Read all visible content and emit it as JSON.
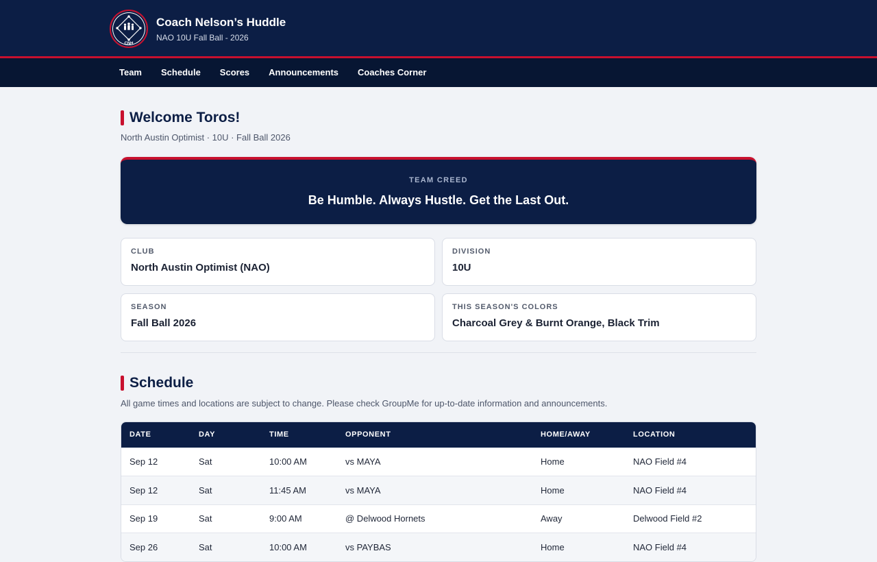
{
  "header": {
    "logo_monogram": "CNH",
    "title": "Coach Nelson’s Huddle",
    "subtitle": "NAO 10U Fall Ball - 2026"
  },
  "nav": {
    "items": [
      {
        "label": "Team"
      },
      {
        "label": "Schedule"
      },
      {
        "label": "Scores"
      },
      {
        "label": "Announcements"
      },
      {
        "label": "Coaches Corner"
      }
    ]
  },
  "welcome": {
    "title": "Welcome Toros!",
    "subline": "North Austin Optimist · 10U · Fall Ball 2026"
  },
  "creed": {
    "label": "TEAM CREED",
    "text": "Be Humble. Always Hustle. Get the Last Out."
  },
  "info": [
    {
      "label": "CLUB",
      "value": "North Austin Optimist (NAO)"
    },
    {
      "label": "DIVISION",
      "value": "10U"
    },
    {
      "label": "SEASON",
      "value": "Fall Ball 2026"
    },
    {
      "label": "THIS SEASON'S COLORS",
      "value": "Charcoal Grey & Burnt Orange, Black Trim"
    }
  ],
  "schedule": {
    "title": "Schedule",
    "note": "All game times and locations are subject to change. Please check GroupMe for up-to-date information and announcements.",
    "columns": [
      "DATE",
      "DAY",
      "TIME",
      "OPPONENT",
      "HOME/AWAY",
      "LOCATION"
    ],
    "rows": [
      [
        "Sep 12",
        "Sat",
        "10:00 AM",
        "vs MAYA",
        "Home",
        "NAO Field #4"
      ],
      [
        "Sep 12",
        "Sat",
        "11:45 AM",
        "vs MAYA",
        "Home",
        "NAO Field #4"
      ],
      [
        "Sep 19",
        "Sat",
        "9:00 AM",
        "@ Delwood Hornets",
        "Away",
        "Delwood Field #2"
      ],
      [
        "Sep 26",
        "Sat",
        "10:00 AM",
        "vs PAYBAS",
        "Home",
        "NAO Field #4"
      ]
    ]
  },
  "colors": {
    "navy": "#0c1e45",
    "nav_dark": "#071633",
    "accent_red": "#c8102e",
    "background": "#f1f3f7"
  }
}
